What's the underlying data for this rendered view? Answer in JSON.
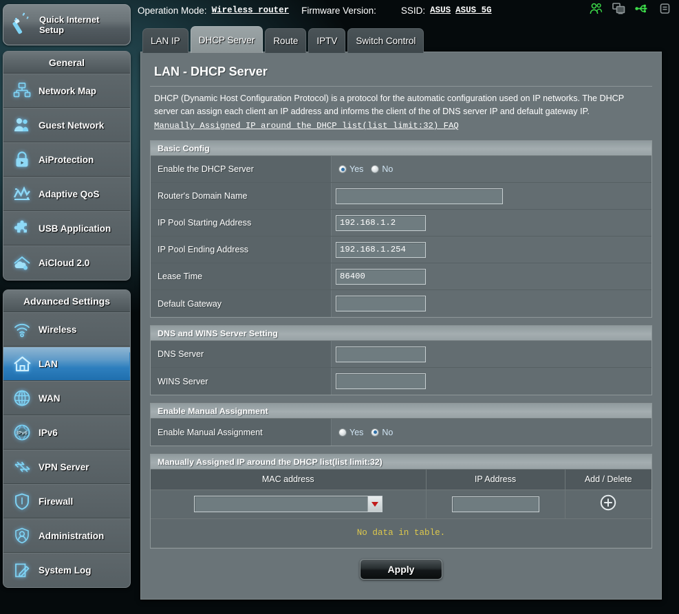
{
  "header": {
    "operation_mode_label": "Operation Mode:",
    "operation_mode_value": "Wireless router",
    "firmware_label": "Firmware Version:",
    "firmware_value": "",
    "ssid_label": "SSID:",
    "ssid_value_1": "ASUS",
    "ssid_value_2": "ASUS_5G",
    "icons": [
      "clients-icon",
      "devices-icon",
      "usb-icon",
      "printer-icon"
    ],
    "accent_green": "#3ddc4a"
  },
  "quick_setup": {
    "label": "Quick Internet Setup",
    "icon": "magic-wand-icon"
  },
  "sidebar": {
    "general": {
      "title": "General",
      "items": [
        {
          "label": "Network Map",
          "icon": "network-map-icon"
        },
        {
          "label": "Guest Network",
          "icon": "guest-network-icon"
        },
        {
          "label": "AiProtection",
          "icon": "lock-icon"
        },
        {
          "label": "Adaptive QoS",
          "icon": "chart-icon"
        },
        {
          "label": "USB Application",
          "icon": "puzzle-icon"
        },
        {
          "label": "AiCloud 2.0",
          "icon": "cloud-icon"
        }
      ]
    },
    "advanced": {
      "title": "Advanced Settings",
      "items": [
        {
          "label": "Wireless",
          "icon": "wifi-icon",
          "active": false
        },
        {
          "label": "LAN",
          "icon": "home-icon",
          "active": true
        },
        {
          "label": "WAN",
          "icon": "globe-icon",
          "active": false
        },
        {
          "label": "IPv6",
          "icon": "ipv6-globe-icon",
          "active": false
        },
        {
          "label": "VPN Server",
          "icon": "vpn-icon",
          "active": false
        },
        {
          "label": "Firewall",
          "icon": "shield-icon",
          "active": false
        },
        {
          "label": "Administration",
          "icon": "user-icon",
          "active": false
        },
        {
          "label": "System Log",
          "icon": "log-icon",
          "active": false
        }
      ]
    }
  },
  "tabs": [
    {
      "label": "LAN IP",
      "active": false
    },
    {
      "label": "DHCP Server",
      "active": true
    },
    {
      "label": "Route",
      "active": false
    },
    {
      "label": "IPTV",
      "active": false
    },
    {
      "label": "Switch Control",
      "active": false
    }
  ],
  "main": {
    "title": "LAN - DHCP Server",
    "description": "DHCP (Dynamic Host Configuration Protocol) is a protocol for the automatic configuration used on IP networks. The DHCP server can assign each client an IP address and informs the client of the of DNS server IP and default gateway IP.",
    "faq_link": "Manually Assigned IP around the DHCP list(list limit:32) FAQ"
  },
  "basic_config": {
    "section_title": "Basic Config",
    "enable_dhcp": {
      "label": "Enable the DHCP Server",
      "options": [
        {
          "label": "Yes",
          "selected": true
        },
        {
          "label": "No",
          "selected": false
        }
      ]
    },
    "domain_name": {
      "label": "Router's Domain Name",
      "value": ""
    },
    "pool_start": {
      "label": "IP Pool Starting Address",
      "value": "192.168.1.2"
    },
    "pool_end": {
      "label": "IP Pool Ending Address",
      "value": "192.168.1.254"
    },
    "lease_time": {
      "label": "Lease Time",
      "value": "86400"
    },
    "default_gateway": {
      "label": "Default Gateway",
      "value": ""
    }
  },
  "dns_wins": {
    "section_title": "DNS and WINS Server Setting",
    "dns_server": {
      "label": "DNS Server",
      "value": ""
    },
    "wins_server": {
      "label": "WINS Server",
      "value": ""
    }
  },
  "manual_assignment": {
    "section_title": "Enable Manual Assignment",
    "enable": {
      "label": "Enable Manual Assignment",
      "options": [
        {
          "label": "Yes",
          "selected": false
        },
        {
          "label": "No",
          "selected": true
        }
      ]
    }
  },
  "assign_table": {
    "section_title": "Manually Assigned IP around the DHCP list(list limit:32)",
    "columns": [
      "MAC address",
      "IP Address",
      "Add / Delete"
    ],
    "input_row": {
      "mac_value": "",
      "ip_value": "",
      "add_icon": "plus-circle-icon"
    },
    "empty_message": "No data in table.",
    "empty_message_color": "#ddc84c"
  },
  "footer": {
    "apply_label": "Apply"
  }
}
